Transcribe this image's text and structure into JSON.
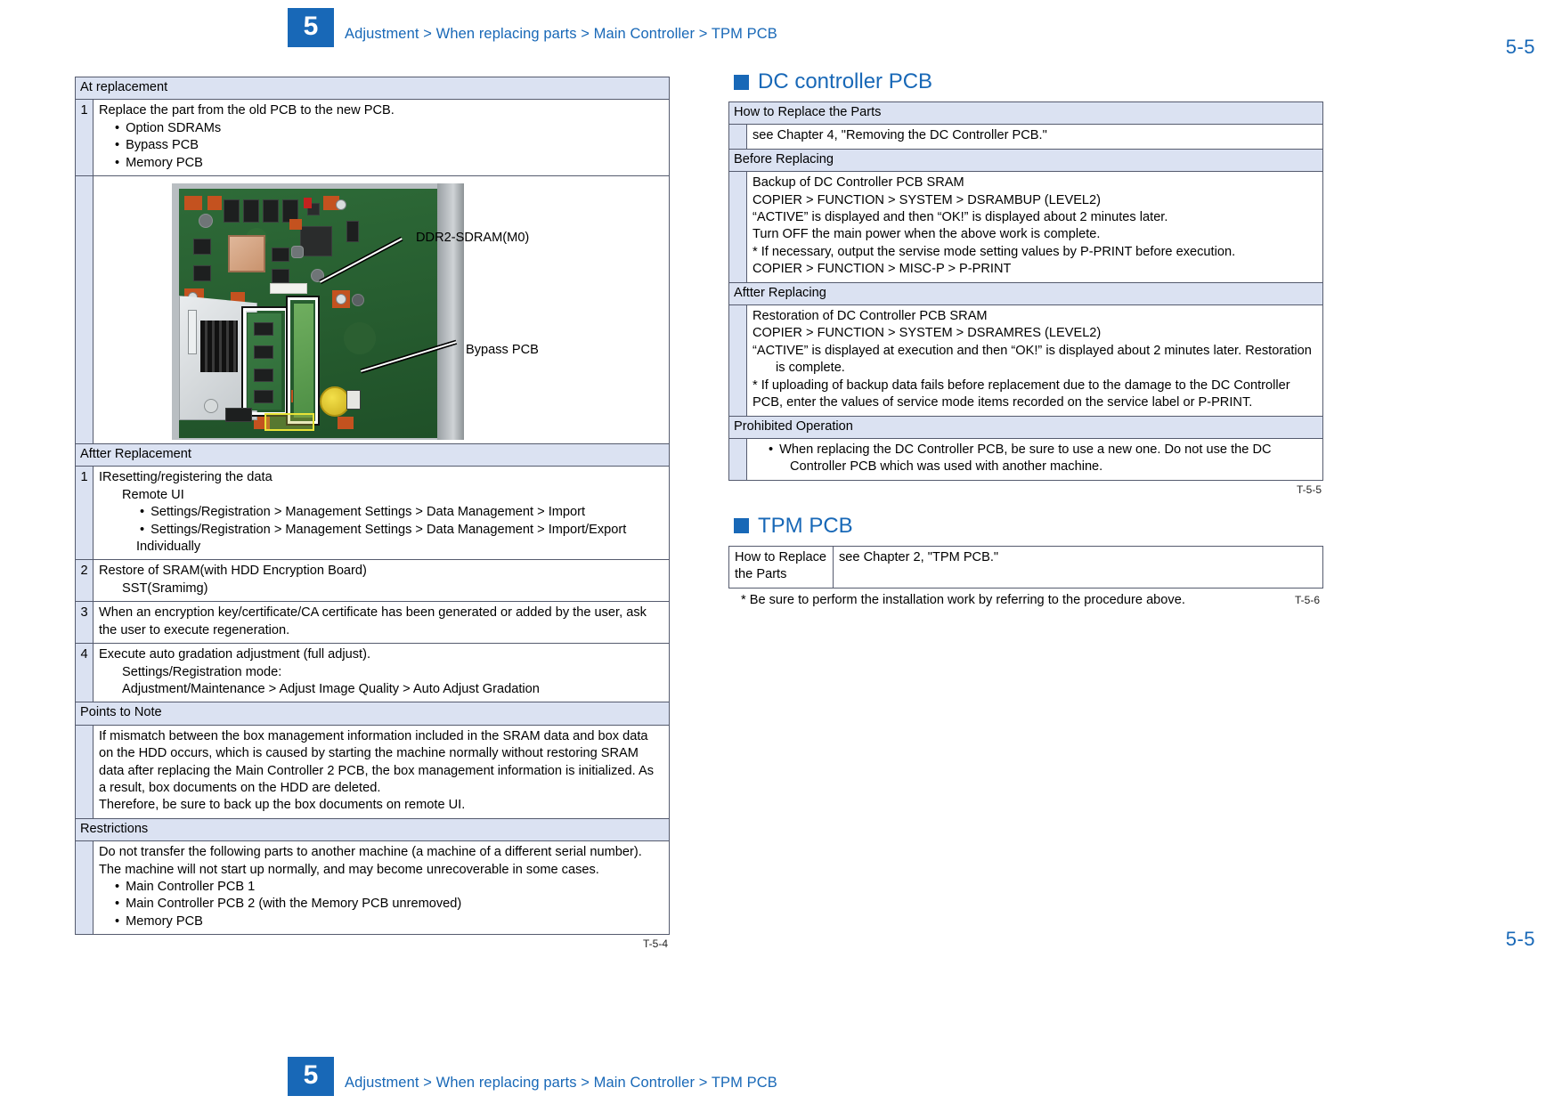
{
  "page": {
    "chapter_number": "5",
    "breadcrumb": "Adjustment > When replacing parts > Main Controller > TPM PCB",
    "folio": "5-5",
    "accent_color": "#1868b7",
    "header_fill": "#dbe2f2"
  },
  "left_column": {
    "table": {
      "caption": "T-5-4",
      "sections": [
        {
          "header": "At replacement",
          "rows": [
            {
              "num": "1",
              "lines": [
                "Replace the part from the old PCB to the new PCB."
              ],
              "bullets": [
                "Option SDRAMs",
                "Bypass PCB",
                "Memory PCB"
              ]
            }
          ]
        },
        {
          "header": "Aftter Replacement",
          "rows": [
            {
              "num": "1",
              "lines": [
                "IResetting/registering the data"
              ],
              "sub": "Remote UI",
              "bullets": [
                "Settings/Registration > Management Settings > Data Management > Import",
                "Settings/Registration > Management Settings > Data Management > Import/Export"
              ],
              "bullet_tail": "Individually"
            },
            {
              "num": "2",
              "lines": [
                "Restore of SRAM(with HDD Encryption Board)"
              ],
              "sub": "SST(Sramimg)"
            },
            {
              "num": "3",
              "lines": [
                "When an encryption key/certificate/CA certificate has been generated or added by the user, ask",
                "the user to execute regeneration."
              ]
            },
            {
              "num": "4",
              "lines": [
                "Execute auto gradation adjustment (full adjust)."
              ],
              "sub": "Settings/Registration mode:",
              "sub2": "Adjustment/Maintenance > Adjust Image Quality > Auto Adjust Gradation"
            }
          ]
        },
        {
          "header": "Points to Note",
          "paragraph": [
            "If mismatch between the box management information included in the SRAM data and box data",
            "on the HDD occurs, which is caused by starting the machine normally without restoring SRAM",
            "data after replacing the Main Controller 2 PCB, the box management information is initialized. As",
            "a result, box documents on the HDD are deleted.",
            "Therefore, be sure to back up the box documents on remote UI."
          ]
        },
        {
          "header": "Restrictions",
          "paragraph": [
            "Do not transfer the following parts to another machine (a machine of a different serial number).",
            "The machine will not start up normally, and may become unrecoverable in some cases."
          ],
          "bullets": [
            "Main Controller PCB 1",
            "Main Controller PCB 2 (with the Memory PCB unremoved)",
            "Memory PCB"
          ]
        }
      ]
    },
    "figure": {
      "callouts": [
        {
          "label": "DDR2-SDRAM(M0)"
        },
        {
          "label": "Bypass PCB"
        }
      ]
    }
  },
  "right_column": {
    "dc_controller": {
      "heading": "DC controller PCB",
      "caption": "T-5-5",
      "sections": [
        {
          "header": "How to Replace the Parts",
          "lines": [
            "see Chapter 4, \"Removing the DC Controller PCB.\""
          ]
        },
        {
          "header": "Before Replacing",
          "lines": [
            "Backup of DC Controller PCB SRAM",
            "COPIER > FUNCTION > SYSTEM > DSRAMBUP (LEVEL2)",
            "“ACTIVE” is displayed and then “OK!” is displayed about 2 minutes later.",
            "Turn OFF the main power when the above work is complete.",
            "* If necessary, output the servise mode setting values by P-PRINT before execution.",
            "COPIER > FUNCTION > MISC-P > P-PRINT"
          ]
        },
        {
          "header": "Aftter Replacing",
          "lines": [
            "Restoration of DC Controller PCB SRAM",
            "COPIER > FUNCTION > SYSTEM > DSRAMRES (LEVEL2)",
            "“ACTIVE” is displayed at execution and then “OK!” is displayed about 2 minutes later. Restoration",
            "is complete.",
            "* If uploading of backup data fails before replacement due to the damage to the DC Controller",
            "PCB, enter the values of service mode items recorded on the service label or P-PRINT."
          ]
        },
        {
          "header": "Prohibited Operation",
          "bullets": [
            "When replacing the DC Controller PCB, be sure to use a new one. Do not use the DC",
            "Controller PCB which was used with another machine."
          ]
        }
      ]
    },
    "tpm": {
      "heading": "TPM PCB",
      "caption": "T-5-6",
      "row_label": "How to Replace the Parts",
      "row_value": "see Chapter 2, \"TPM PCB.\"",
      "note": "* Be sure to perform the installation work by referring to the procedure above."
    }
  }
}
